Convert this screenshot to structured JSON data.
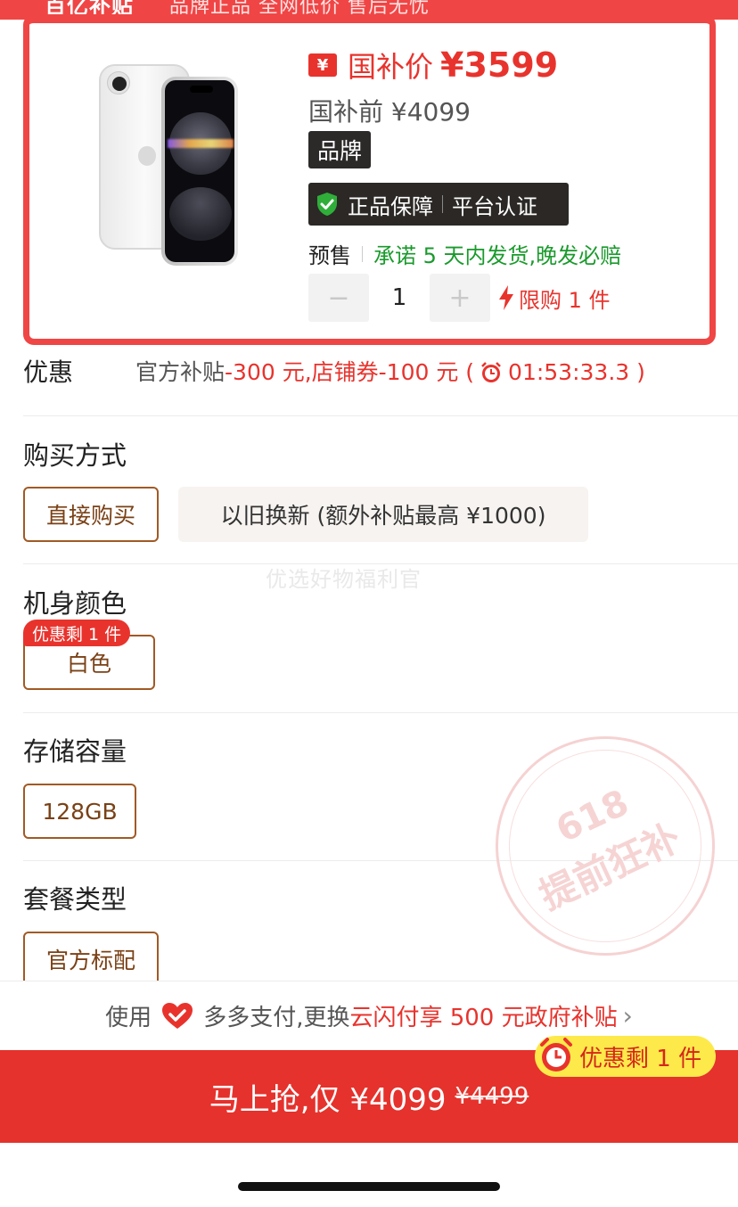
{
  "banner": {
    "title": "百亿补贴",
    "subtitle": "品牌正品 全网低价 售后无忧"
  },
  "product": {
    "yen_glyph": "¥",
    "subsidy_label": "国补价",
    "subsidy_price": "¥3599",
    "original_price": "国补前 ¥4099",
    "brand_tag": "品牌",
    "assurance_1": "正品保障",
    "assurance_2": "平台认证",
    "presale_label": "预售",
    "presale_promise": "承诺 5 天内发货,晚发必赔",
    "minus": "−",
    "quantity": "1",
    "plus": "+",
    "limit_text": "限购 1 件"
  },
  "discount": {
    "title": "优惠",
    "official": "官方补贴",
    "official_amount": "-300 元",
    "shop_coupon": ",店铺券-100 元 (",
    "countdown": "01:53:33.3 )"
  },
  "purchase_method": {
    "title": "购买方式",
    "options": [
      "直接购买",
      "以旧换新 (额外补贴最高 ¥1000)"
    ]
  },
  "watermark": "优选好物福利官",
  "color": {
    "title": "机身颜色",
    "badge": "优惠剩 1 件",
    "option": "白色"
  },
  "storage": {
    "title": "存储容量",
    "option": "128GB"
  },
  "package": {
    "title": "套餐类型",
    "option": "官方标配"
  },
  "stamp": {
    "line1": "618",
    "line2": "提前狂补"
  },
  "pay_bar": {
    "prefix": "使用",
    "method": "多多支付,更换",
    "highlight": "云闪付享 500 元政府补贴",
    "chevron": "›"
  },
  "buy": {
    "label": "马上抢,仅 ¥4099",
    "strike_price": "¥4499",
    "badge": "优惠剩 1 件"
  },
  "colors": {
    "accent_red": "#e8332d",
    "option_brown": "#a05a25",
    "promise_green": "#1a9a2c",
    "badge_yellow": "#fde94a"
  }
}
